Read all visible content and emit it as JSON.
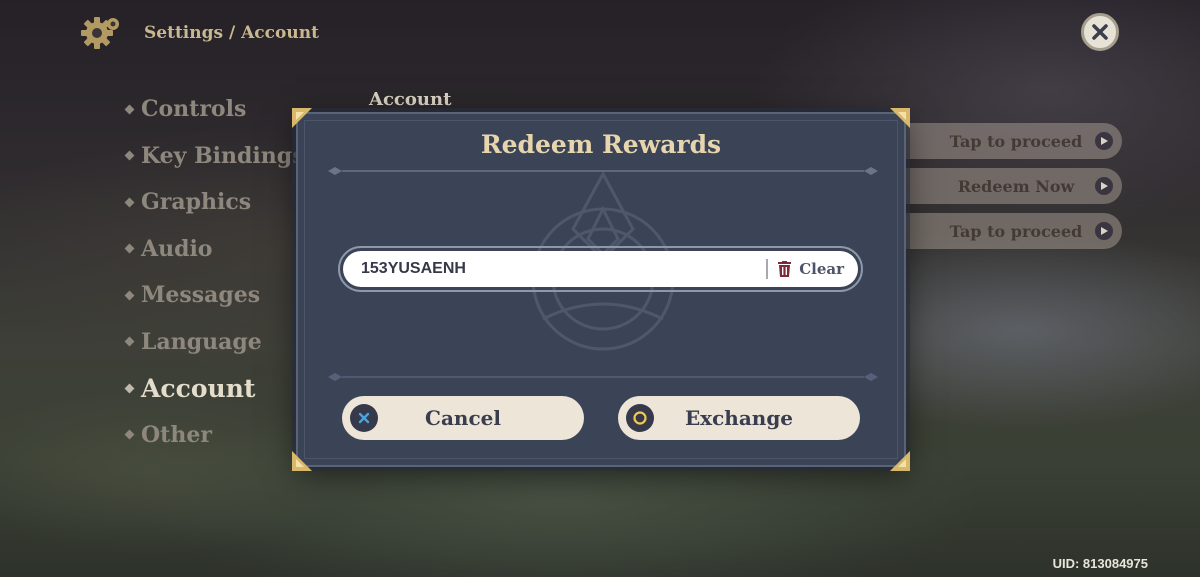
{
  "header": {
    "breadcrumb": "Settings / Account"
  },
  "nav": {
    "items": [
      {
        "label": "Controls"
      },
      {
        "label": "Key Bindings"
      },
      {
        "label": "Graphics"
      },
      {
        "label": "Audio"
      },
      {
        "label": "Messages"
      },
      {
        "label": "Language"
      },
      {
        "label": "Account"
      },
      {
        "label": "Other"
      }
    ],
    "active": "Account"
  },
  "section": {
    "title": "Account"
  },
  "side_buttons": [
    {
      "label": "Tap to proceed"
    },
    {
      "label": "Redeem Now"
    },
    {
      "label": "Tap to proceed"
    }
  ],
  "modal": {
    "title": "Redeem Rewards",
    "code_value": "153YUSAENH",
    "clear_label": "Clear",
    "cancel_label": "Cancel",
    "exchange_label": "Exchange"
  },
  "footer": {
    "uid": "UID: 813084975"
  },
  "colors": {
    "modal_bg": "#3b4456",
    "title_gold": "#e7d6ad",
    "button_bg": "#ece5d8",
    "cancel_icon": "#4aa3e0",
    "exchange_icon": "#f2c94c",
    "clear_icon": "#7a2a3a"
  },
  "icons": {
    "settings": "gear-icon",
    "close": "close-icon",
    "clear": "trash-icon",
    "cancel": "cross-icon",
    "exchange": "circle-icon",
    "proceed": "play-arrow-icon"
  }
}
